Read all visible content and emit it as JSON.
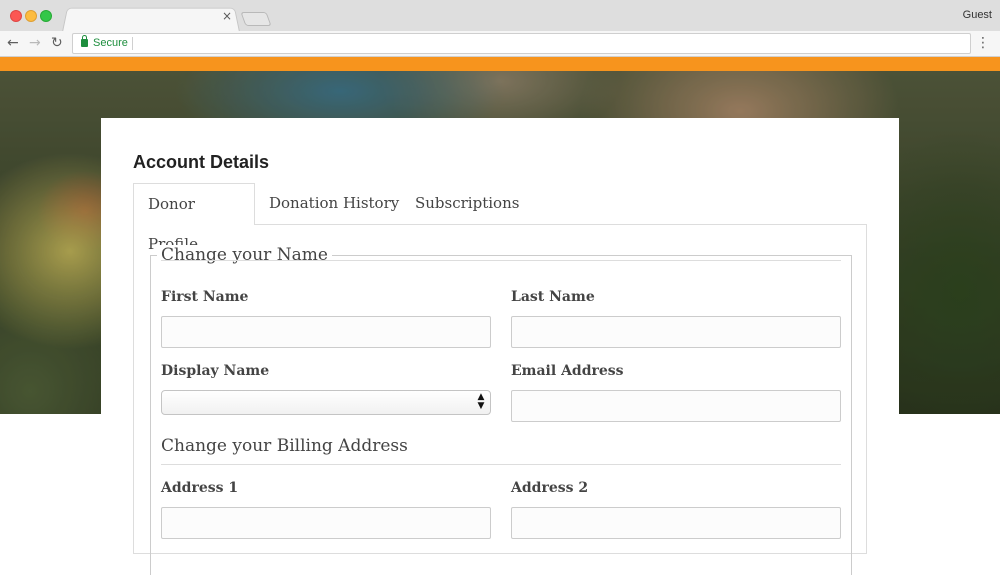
{
  "browser": {
    "profile_label": "Guest",
    "security_label": "Secure",
    "tab_close_glyph": "×",
    "nav": {
      "back_icon": "arrow-left-icon",
      "forward_icon": "arrow-right-icon",
      "reload_icon": "reload-icon",
      "menu_icon": "kebab-menu-icon"
    }
  },
  "colors": {
    "accent_bar": "#f7941d",
    "secure_green": "#1e8e3e"
  },
  "account": {
    "title": "Account Details",
    "tabs": [
      {
        "label": "Donor Profile",
        "active": true
      },
      {
        "label": "Donation History",
        "active": false
      },
      {
        "label": "Subscriptions",
        "active": false
      }
    ],
    "name_section": {
      "legend": "Change your Name",
      "first_name_label": "First Name",
      "first_name_value": "",
      "last_name_label": "Last Name",
      "last_name_value": "",
      "display_name_label": "Display Name",
      "display_name_value": "",
      "email_label": "Email Address",
      "email_value": ""
    },
    "billing_section": {
      "title": "Change your Billing Address",
      "address1_label": "Address 1",
      "address2_label": "Address 2"
    }
  }
}
